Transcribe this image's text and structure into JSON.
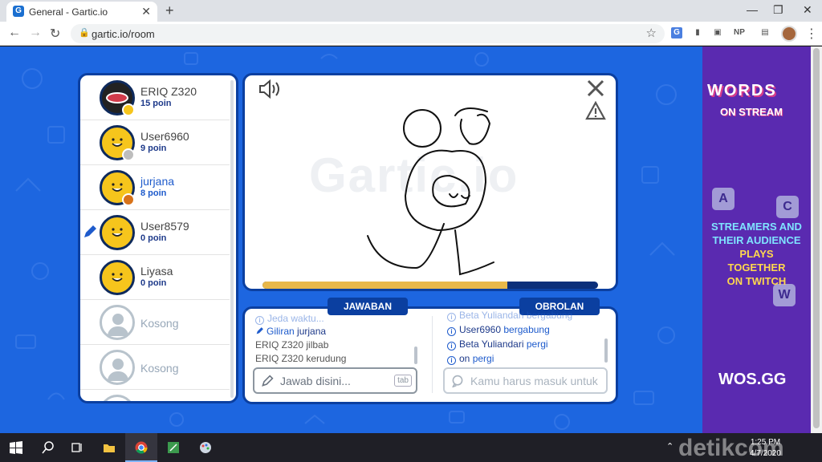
{
  "browser": {
    "tab_title": "General - Gartic.io",
    "tab_close": "✕",
    "new_tab": "+",
    "url": "gartic.io/room",
    "extensions": [
      "G",
      "NP"
    ],
    "favicon_letter": "G"
  },
  "players": [
    {
      "name": "ERIQ Z320",
      "score": "15 poin",
      "type": "special",
      "medal": "#f6c51c"
    },
    {
      "name": "User6960",
      "score": "9 poin",
      "type": "face",
      "medal": "#bdbdbd"
    },
    {
      "name": "jurjana",
      "score": "8 poin",
      "type": "face",
      "medal": "#d8731a",
      "drawing": true
    },
    {
      "name": "User8579",
      "score": "0 poin",
      "type": "face"
    },
    {
      "name": "Liyasa",
      "score": "0 poin",
      "type": "face"
    },
    {
      "name": "Kosong",
      "score": "",
      "type": "empty"
    },
    {
      "name": "Kosong",
      "score": "",
      "type": "empty"
    }
  ],
  "canvas": {
    "watermark": "Gartic.io",
    "timer_progress": 0.73
  },
  "answer": {
    "label": "JAWABAN",
    "partial_line": "Jeda waktu...",
    "turn_prefix": "Giliran",
    "turn_name": "jurjana",
    "lines": [
      {
        "user": "ERIQ Z320",
        "text": "jilbab"
      },
      {
        "user": "ERIQ Z320",
        "text": "kerudung"
      }
    ],
    "placeholder": "Jawab disini...",
    "key_hint": "tab"
  },
  "chat": {
    "label": "OBROLAN",
    "partial_line": "Beta Yuliandari bergabung",
    "lines": [
      {
        "user": "User6960",
        "text": "bergabung"
      },
      {
        "user": "Beta Yuliandari",
        "text": "pergi"
      },
      {
        "user": "on",
        "text": "pergi"
      }
    ],
    "placeholder": "Kamu harus masuk untuk"
  },
  "ad": {
    "logo_top": "WORDS",
    "logo_bottom": "ON STREAM",
    "tagline_1": "STREAMERS AND",
    "tagline_2": "THEIR AUDIENCE",
    "tagline_3": "PLAYS TOGETHER",
    "tagline_4": "ON TWITCH",
    "tiles": [
      "A",
      "C",
      "W"
    ],
    "site": "WOS.GG"
  },
  "taskbar": {
    "time": "1:25 PM",
    "date": "4/7/2020",
    "watermark": "detikcom"
  },
  "colors": {
    "game_bg": "#1d66e0",
    "panel_border": "#0b3fa0",
    "accent_blue": "#1e5bcc",
    "timer_fill": "#e8b84a"
  }
}
